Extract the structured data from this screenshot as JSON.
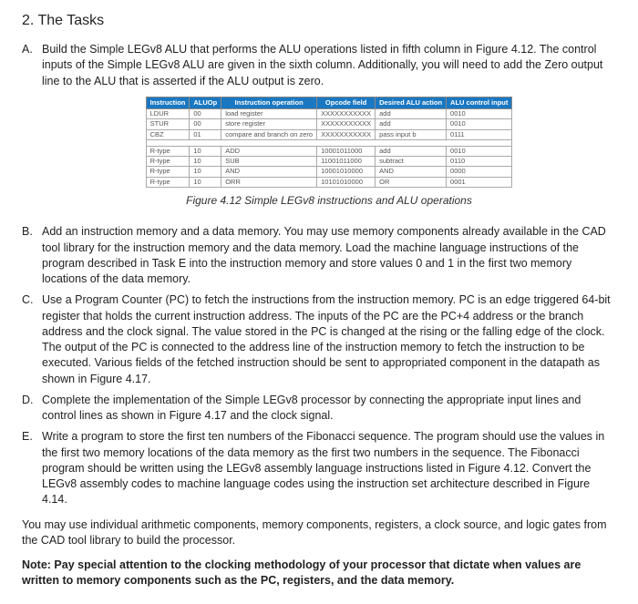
{
  "heading": "2. The Tasks",
  "tasks": {
    "A": {
      "letter": "A.",
      "body": "Build the Simple LEGv8 ALU that performs the ALU operations listed in fifth column in Figure 4.12. The control inputs of the Simple LEGv8 ALU are given in the sixth column. Additionally, you will need to add the Zero output line to the ALU that is asserted if the ALU output is zero."
    },
    "B": {
      "letter": "B.",
      "body": "Add an instruction memory and a data memory. You may use memory components already available in the CAD tool library for the instruction memory and the data memory. Load the machine language instructions of the program described in Task E into the instruction memory and store values 0 and 1 in the first two memory locations of the data memory."
    },
    "C": {
      "letter": "C.",
      "body": "Use a Program Counter (PC) to fetch the instructions from the instruction memory. PC is an edge triggered 64-bit register that holds the current instruction address. The inputs of the PC are the PC+4 address or the branch address and the clock signal. The value stored in the PC is changed at the rising or the falling edge of the clock. The output of the PC is connected to the address line of the instruction memory to fetch the instruction to be executed. Various fields of the fetched instruction should be sent to appropriated component in the datapath as shown in Figure 4.17."
    },
    "D": {
      "letter": "D.",
      "body": "Complete the implementation of the Simple LEGv8 processor by connecting the appropriate input lines and control lines as shown in Figure 4.17 and the clock signal."
    },
    "E": {
      "letter": "E.",
      "body": "Write a program to store the first ten numbers of the Fibonacci sequence. The program should use the values in the first two memory locations of the data memory as the first two numbers in the sequence. The Fibonacci program should be written using the LEGv8 assembly language instructions listed in Figure 4.12. Convert the LEGv8 assembly codes to machine language codes using the instruction set architecture described in Figure 4.14."
    }
  },
  "table": {
    "headers": [
      "Instruction",
      "ALUOp",
      "Instruction operation",
      "Opcode field",
      "Desired ALU action",
      "ALU control input"
    ],
    "rows_top": [
      [
        "LDUR",
        "00",
        "load register",
        "XXXXXXXXXXX",
        "add",
        "0010"
      ],
      [
        "STUR",
        "00",
        "store register",
        "XXXXXXXXXXX",
        "add",
        "0010"
      ],
      [
        "CBZ",
        "01",
        "compare and branch on zero",
        "XXXXXXXXXXX",
        "pass input b",
        "0111"
      ]
    ],
    "rows_bottom": [
      [
        "R-type",
        "10",
        "ADD",
        "10001011000",
        "add",
        "0010"
      ],
      [
        "R-type",
        "10",
        "SUB",
        "11001011000",
        "subtract",
        "0110"
      ],
      [
        "R-type",
        "10",
        "AND",
        "10001010000",
        "AND",
        "0000"
      ],
      [
        "R-type",
        "10",
        "ORR",
        "10101010000",
        "OR",
        "0001"
      ]
    ]
  },
  "caption": "Figure 4.12 Simple LEGv8 instructions and ALU operations",
  "closing": "You may use individual arithmetic components, memory components, registers, a clock source, and logic gates from the CAD tool library to build the processor.",
  "note": "Note: Pay special attention to the clocking methodology of your processor that dictate when values are written to memory components such as the PC, registers, and the data memory."
}
